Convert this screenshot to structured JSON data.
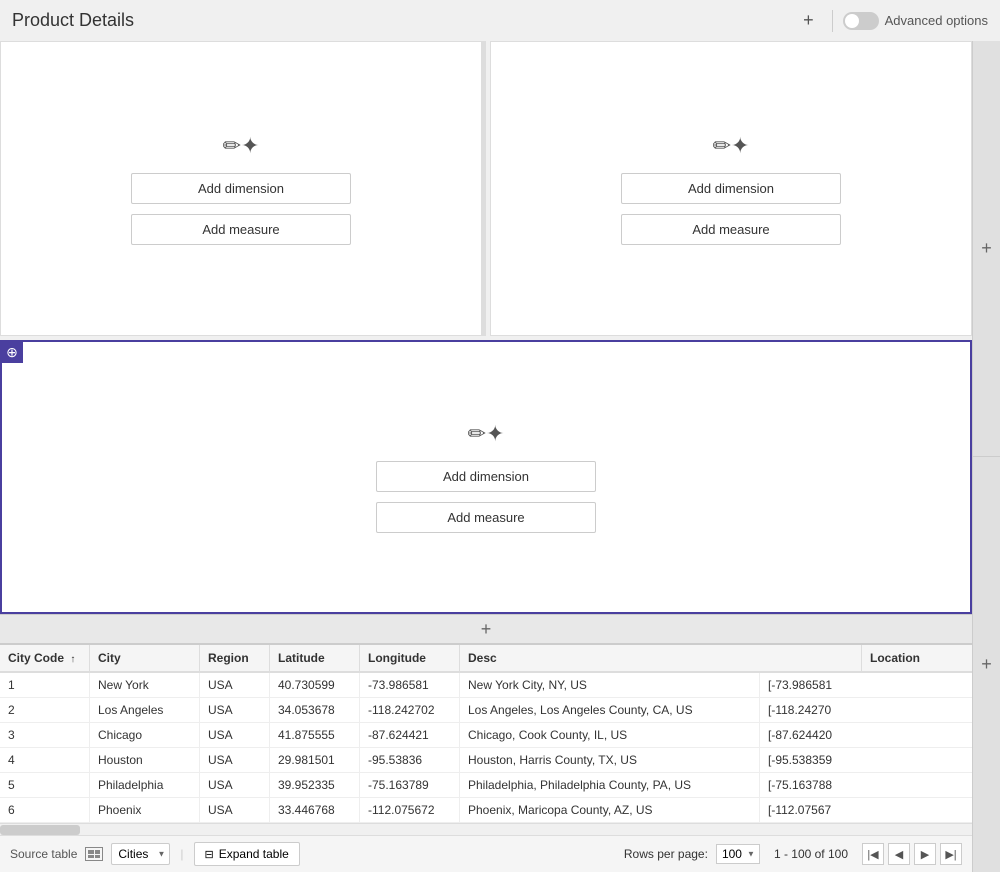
{
  "header": {
    "title": "Product Details",
    "add_label": "+",
    "advanced_label": "Advanced options"
  },
  "panels": {
    "top_left": {
      "wand": "✏️",
      "add_dimension": "Add dimension",
      "add_measure": "Add measure"
    },
    "top_right": {
      "wand": "✏️",
      "add_dimension": "Add dimension",
      "add_measure": "Add measure"
    },
    "bottom": {
      "wand": "✏️",
      "add_dimension": "Add dimension",
      "add_measure": "Add measure"
    }
  },
  "table": {
    "columns": [
      {
        "key": "city_code",
        "label": "City Code",
        "sorted": "asc"
      },
      {
        "key": "city",
        "label": "City",
        "sorted": null
      },
      {
        "key": "region",
        "label": "Region",
        "sorted": null
      },
      {
        "key": "latitude",
        "label": "Latitude",
        "sorted": null
      },
      {
        "key": "longitude",
        "label": "Longitude",
        "sorted": null
      },
      {
        "key": "desc",
        "label": "Desc",
        "sorted": null
      },
      {
        "key": "location",
        "label": "Location",
        "sorted": null
      }
    ],
    "rows": [
      {
        "city_code": "1",
        "city": "New York",
        "region": "USA",
        "latitude": "40.730599",
        "longitude": "-73.986581",
        "desc": "New York City, NY, US",
        "location": "[-73.986581"
      },
      {
        "city_code": "2",
        "city": "Los Angeles",
        "region": "USA",
        "latitude": "34.053678",
        "longitude": "-118.242702",
        "desc": "Los Angeles, Los Angeles County, CA, US",
        "location": "[-118.24270"
      },
      {
        "city_code": "3",
        "city": "Chicago",
        "region": "USA",
        "latitude": "41.875555",
        "longitude": "-87.624421",
        "desc": "Chicago, Cook County, IL, US",
        "location": "[-87.624420"
      },
      {
        "city_code": "4",
        "city": "Houston",
        "region": "USA",
        "latitude": "29.981501",
        "longitude": "-95.53836",
        "desc": "Houston, Harris County, TX, US",
        "location": "[-95.538359"
      },
      {
        "city_code": "5",
        "city": "Philadelphia",
        "region": "USA",
        "latitude": "39.952335",
        "longitude": "-75.163789",
        "desc": "Philadelphia, Philadelphia County, PA, US",
        "location": "[-75.163788"
      },
      {
        "city_code": "6",
        "city": "Phoenix",
        "region": "USA",
        "latitude": "33.446768",
        "longitude": "-112.075672",
        "desc": "Phoenix, Maricopa County, AZ, US",
        "location": "[-112.07567"
      }
    ]
  },
  "footer": {
    "source_label": "Source table",
    "table_name": "Cities",
    "expand_label": "Expand table",
    "rows_per_page_label": "Rows per page:",
    "rows_per_page_value": "100",
    "page_range": "1 - 100 of 100"
  }
}
